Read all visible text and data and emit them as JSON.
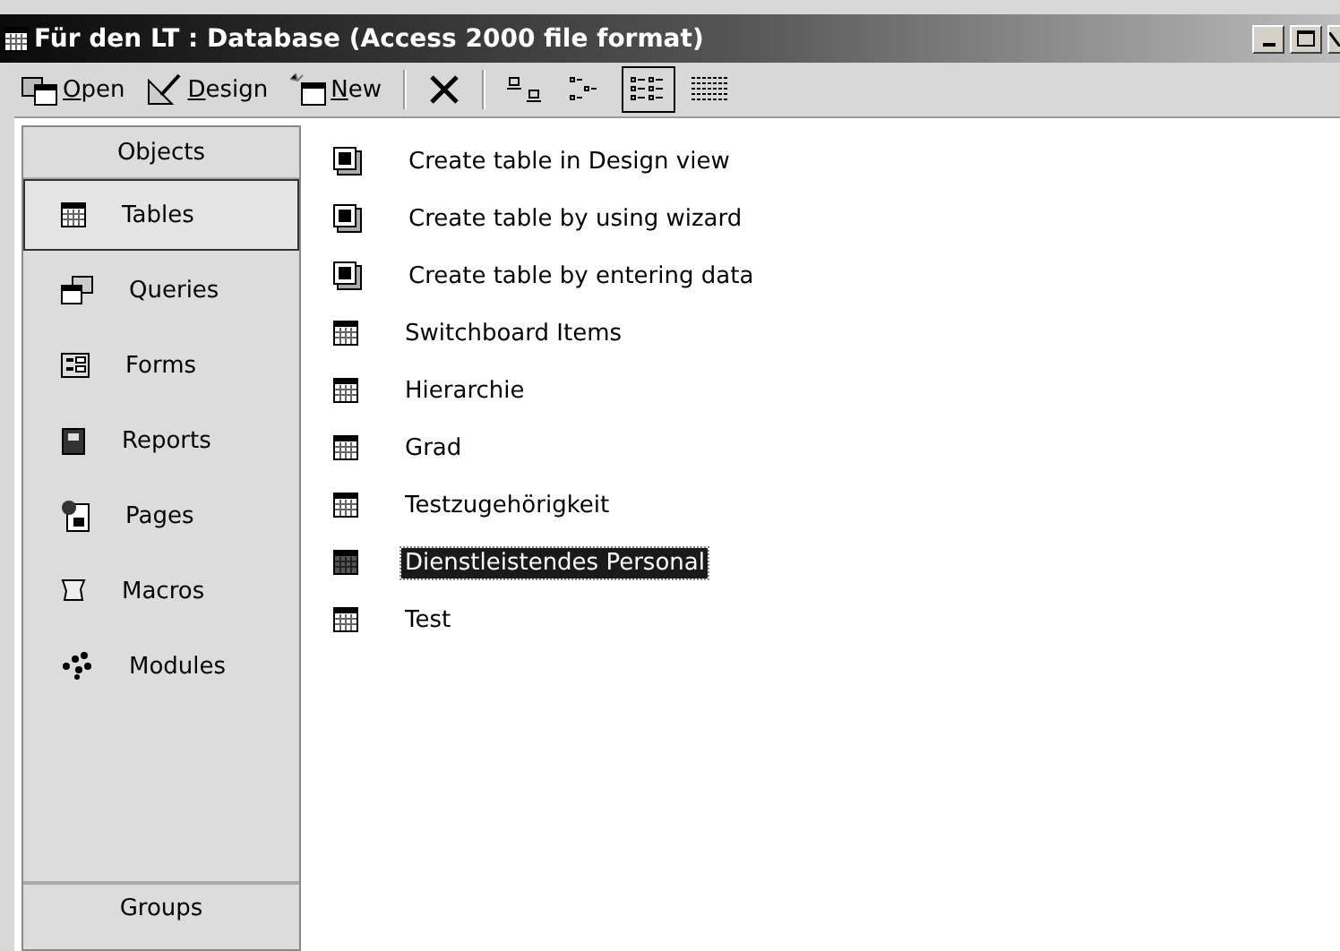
{
  "window": {
    "title": "Für den LT : Database (Access 2000 file format)"
  },
  "toolbar": [
    {
      "kind": "open",
      "label": "Open"
    },
    {
      "kind": "design",
      "label": "Design"
    },
    {
      "kind": "new",
      "label": "New"
    },
    {
      "kind": "delete"
    },
    {
      "kind": "large",
      "selected": false
    },
    {
      "kind": "small",
      "selected": false
    },
    {
      "kind": "list",
      "selected": true
    },
    {
      "kind": "details",
      "selected": false
    }
  ],
  "sidebar": {
    "header": "Objects",
    "footer": "Groups",
    "items": [
      {
        "kind": "table",
        "label": "Tables",
        "selected": true
      },
      {
        "kind": "query",
        "label": "Queries",
        "selected": false
      },
      {
        "kind": "form",
        "label": "Forms",
        "selected": false
      },
      {
        "kind": "report",
        "label": "Reports",
        "selected": false
      },
      {
        "kind": "page",
        "label": "Pages",
        "selected": false
      },
      {
        "kind": "macro",
        "label": "Macros",
        "selected": false
      },
      {
        "kind": "module",
        "label": "Modules",
        "selected": false
      }
    ]
  },
  "objects": [
    {
      "kind": "shortcut",
      "label": "Create table in Design view",
      "selected": false
    },
    {
      "kind": "shortcut",
      "label": "Create table by using wizard",
      "selected": false
    },
    {
      "kind": "shortcut",
      "label": "Create table by entering data",
      "selected": false
    },
    {
      "kind": "table",
      "label": "Switchboard Items",
      "selected": false
    },
    {
      "kind": "table",
      "label": "Hierarchie",
      "selected": false
    },
    {
      "kind": "table",
      "label": "Grad",
      "selected": false
    },
    {
      "kind": "table",
      "label": "Testzugehörigkeit",
      "selected": false
    },
    {
      "kind": "table",
      "label": "Dienstleistendes Personal",
      "selected": true
    },
    {
      "kind": "table",
      "label": "Test",
      "selected": false
    }
  ]
}
